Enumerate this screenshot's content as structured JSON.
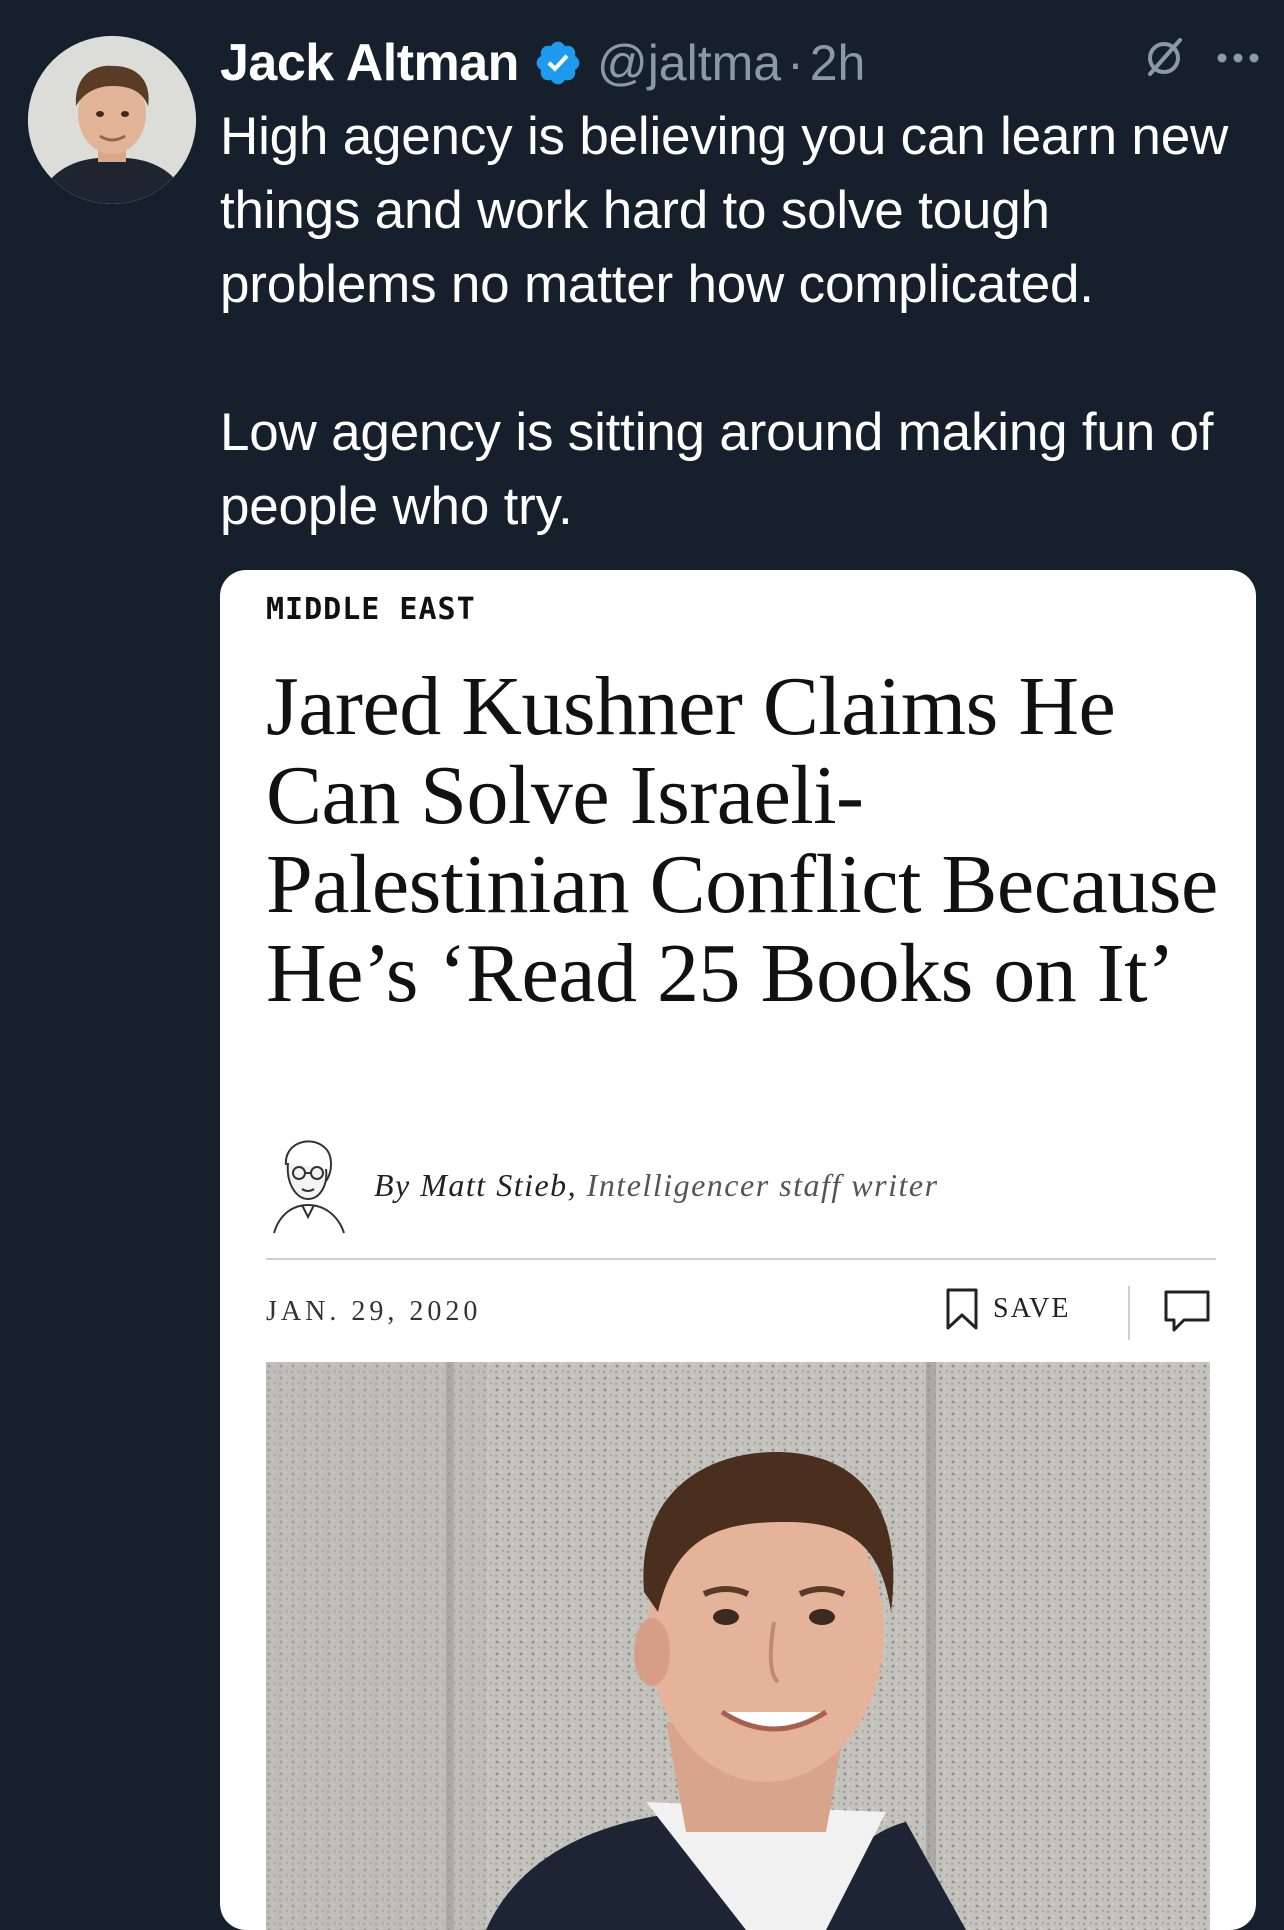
{
  "tweet": {
    "author_name": "Jack Altman",
    "handle": "@jaltma",
    "separator": "·",
    "time": "2h",
    "text": "High agency is believing you can learn new things and work hard to solve tough problems no matter how complicated.\n\nLow agency is sitting around making fun of people who try.",
    "icons": {
      "avatar": "author-avatar",
      "verified": "verified-badge-icon",
      "grok": "slashed-circle-icon",
      "more": "more-options-icon"
    }
  },
  "article_card": {
    "section": "MIDDLE EAST",
    "headline": "Jared Kushner Claims He Can Solve Israeli-Palestinian Conflict Because He’s ‘Read 25 Books on It’",
    "byline_author": "By Matt Stieb,",
    "byline_role": "Intelligencer staff writer",
    "date": "JAN. 29, 2020",
    "save_label": "SAVE",
    "icons": {
      "bookmark": "bookmark-icon",
      "comment": "comment-icon",
      "author_sketch": "author-sketch-illustration",
      "photo": "article-photo"
    }
  },
  "colors": {
    "background": "#16202c",
    "text_primary": "#ffffff",
    "text_secondary": "#8b98a5",
    "verified_blue": "#1d9bf0",
    "card_background": "#ffffff"
  }
}
